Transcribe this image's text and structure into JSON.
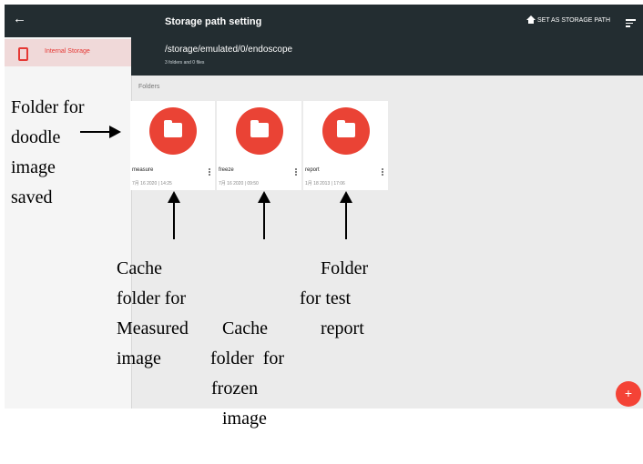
{
  "app": {
    "back_glyph": "←",
    "title": "Storage path setting",
    "path": "/storage/emulated/0/endoscope",
    "count": "3 folders and 0 files",
    "set_storage": "SET AS STORAGE PATH",
    "accent_color": "#ea4335"
  },
  "sidebar": {
    "items": [
      {
        "label": "Internal Storage",
        "icon": "phone-icon"
      }
    ]
  },
  "content": {
    "section_label": "Folders",
    "folders": [
      {
        "name": "measure",
        "date": "7月 16 2020 | 14:25"
      },
      {
        "name": "freeze",
        "date": "7月 16 2020 | 09:50"
      },
      {
        "name": "report",
        "date": "1月 18 2013 | 17:06"
      }
    ]
  },
  "fab": {
    "label": "+"
  },
  "annotations": {
    "left": [
      "Folder for",
      "doodle",
      "image",
      "saved"
    ],
    "measure": [
      "Cache",
      "folder for",
      "Measured",
      "image"
    ],
    "freeze": [
      "Cache",
      "folder  for",
      "frozen",
      "image"
    ],
    "report": [
      "Folder",
      "for test",
      "report"
    ]
  }
}
